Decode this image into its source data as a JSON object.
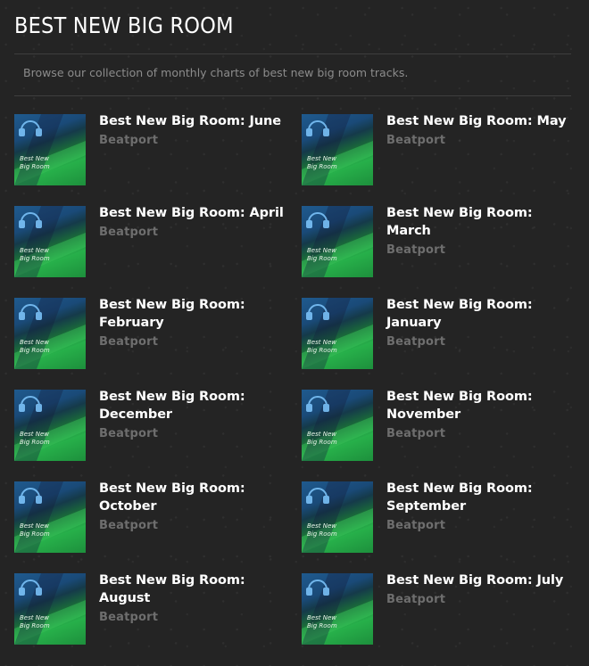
{
  "header": {
    "title": "BEST NEW BIG ROOM",
    "description": "Browse our collection of monthly charts of best new big room tracks."
  },
  "artwork": {
    "line1": "Best New",
    "line2": "Big Room",
    "icon": "headphones-icon"
  },
  "charts": [
    {
      "title": "Best New Big Room: June",
      "label": "Beatport"
    },
    {
      "title": "Best New Big Room: May",
      "label": "Beatport"
    },
    {
      "title": "Best New Big Room: April",
      "label": "Beatport"
    },
    {
      "title": "Best New Big Room: March",
      "label": "Beatport"
    },
    {
      "title": "Best New Big Room: February",
      "label": "Beatport"
    },
    {
      "title": "Best New Big Room: January",
      "label": "Beatport"
    },
    {
      "title": "Best New Big Room: December",
      "label": "Beatport"
    },
    {
      "title": "Best New Big Room: November",
      "label": "Beatport"
    },
    {
      "title": "Best New Big Room: October",
      "label": "Beatport"
    },
    {
      "title": "Best New Big Room: September",
      "label": "Beatport"
    },
    {
      "title": "Best New Big Room: August",
      "label": "Beatport"
    },
    {
      "title": "Best New Big Room: July",
      "label": "Beatport"
    }
  ]
}
